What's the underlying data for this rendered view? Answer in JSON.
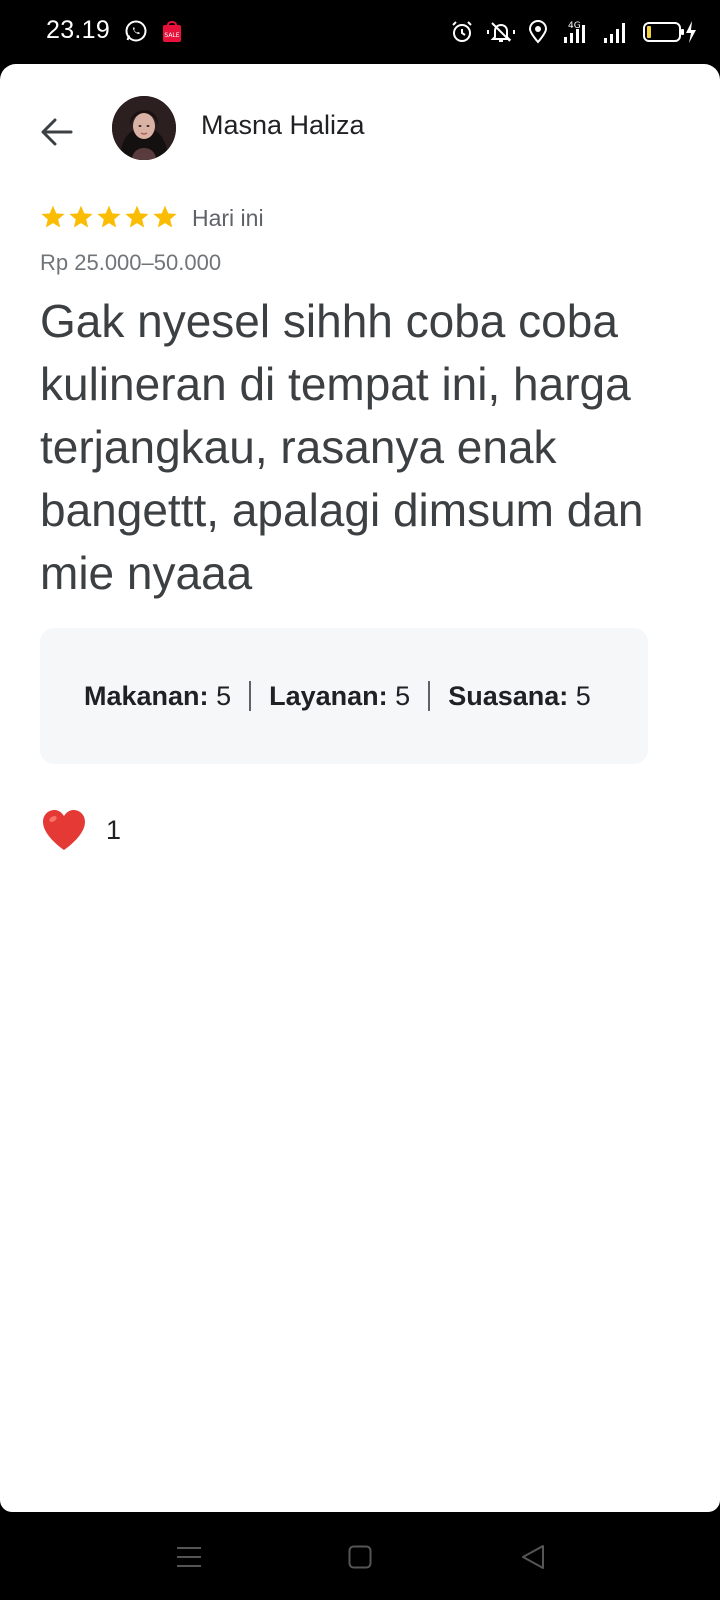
{
  "status_bar": {
    "time": "23.19",
    "network": "4G",
    "left_icons": [
      "whatsapp-icon",
      "shopping-sale-icon"
    ],
    "right_icons": [
      "alarm-icon",
      "mute-icon",
      "location-icon",
      "signal-4g-icon",
      "signal-icon",
      "battery-charging-icon"
    ]
  },
  "header": {
    "back_icon": "arrow-left-icon",
    "reviewer_name": "Masna Haliza"
  },
  "review": {
    "rating": 5,
    "max_rating": 5,
    "date": "Hari ini",
    "price_range": "Rp 25.000–50.000",
    "text": "Gak nyesel sihhh coba coba kulineran di tempat ini, harga terjangkau, rasanya enak bangettt, apalagi dimsum dan mie nyaaa"
  },
  "sub_ratings": [
    {
      "label": "Makanan:",
      "value": "5"
    },
    {
      "label": "Layanan:",
      "value": "5"
    },
    {
      "label": "Suasana:",
      "value": "5"
    }
  ],
  "reactions": {
    "icon": "heart-icon",
    "count": "1"
  },
  "colors": {
    "star": "#fbbc04",
    "heart": "#e53935",
    "box_bg": "#f6f7f9"
  },
  "nav_bar": {
    "buttons": [
      "menu-icon",
      "home-icon",
      "back-triangle-icon"
    ]
  }
}
